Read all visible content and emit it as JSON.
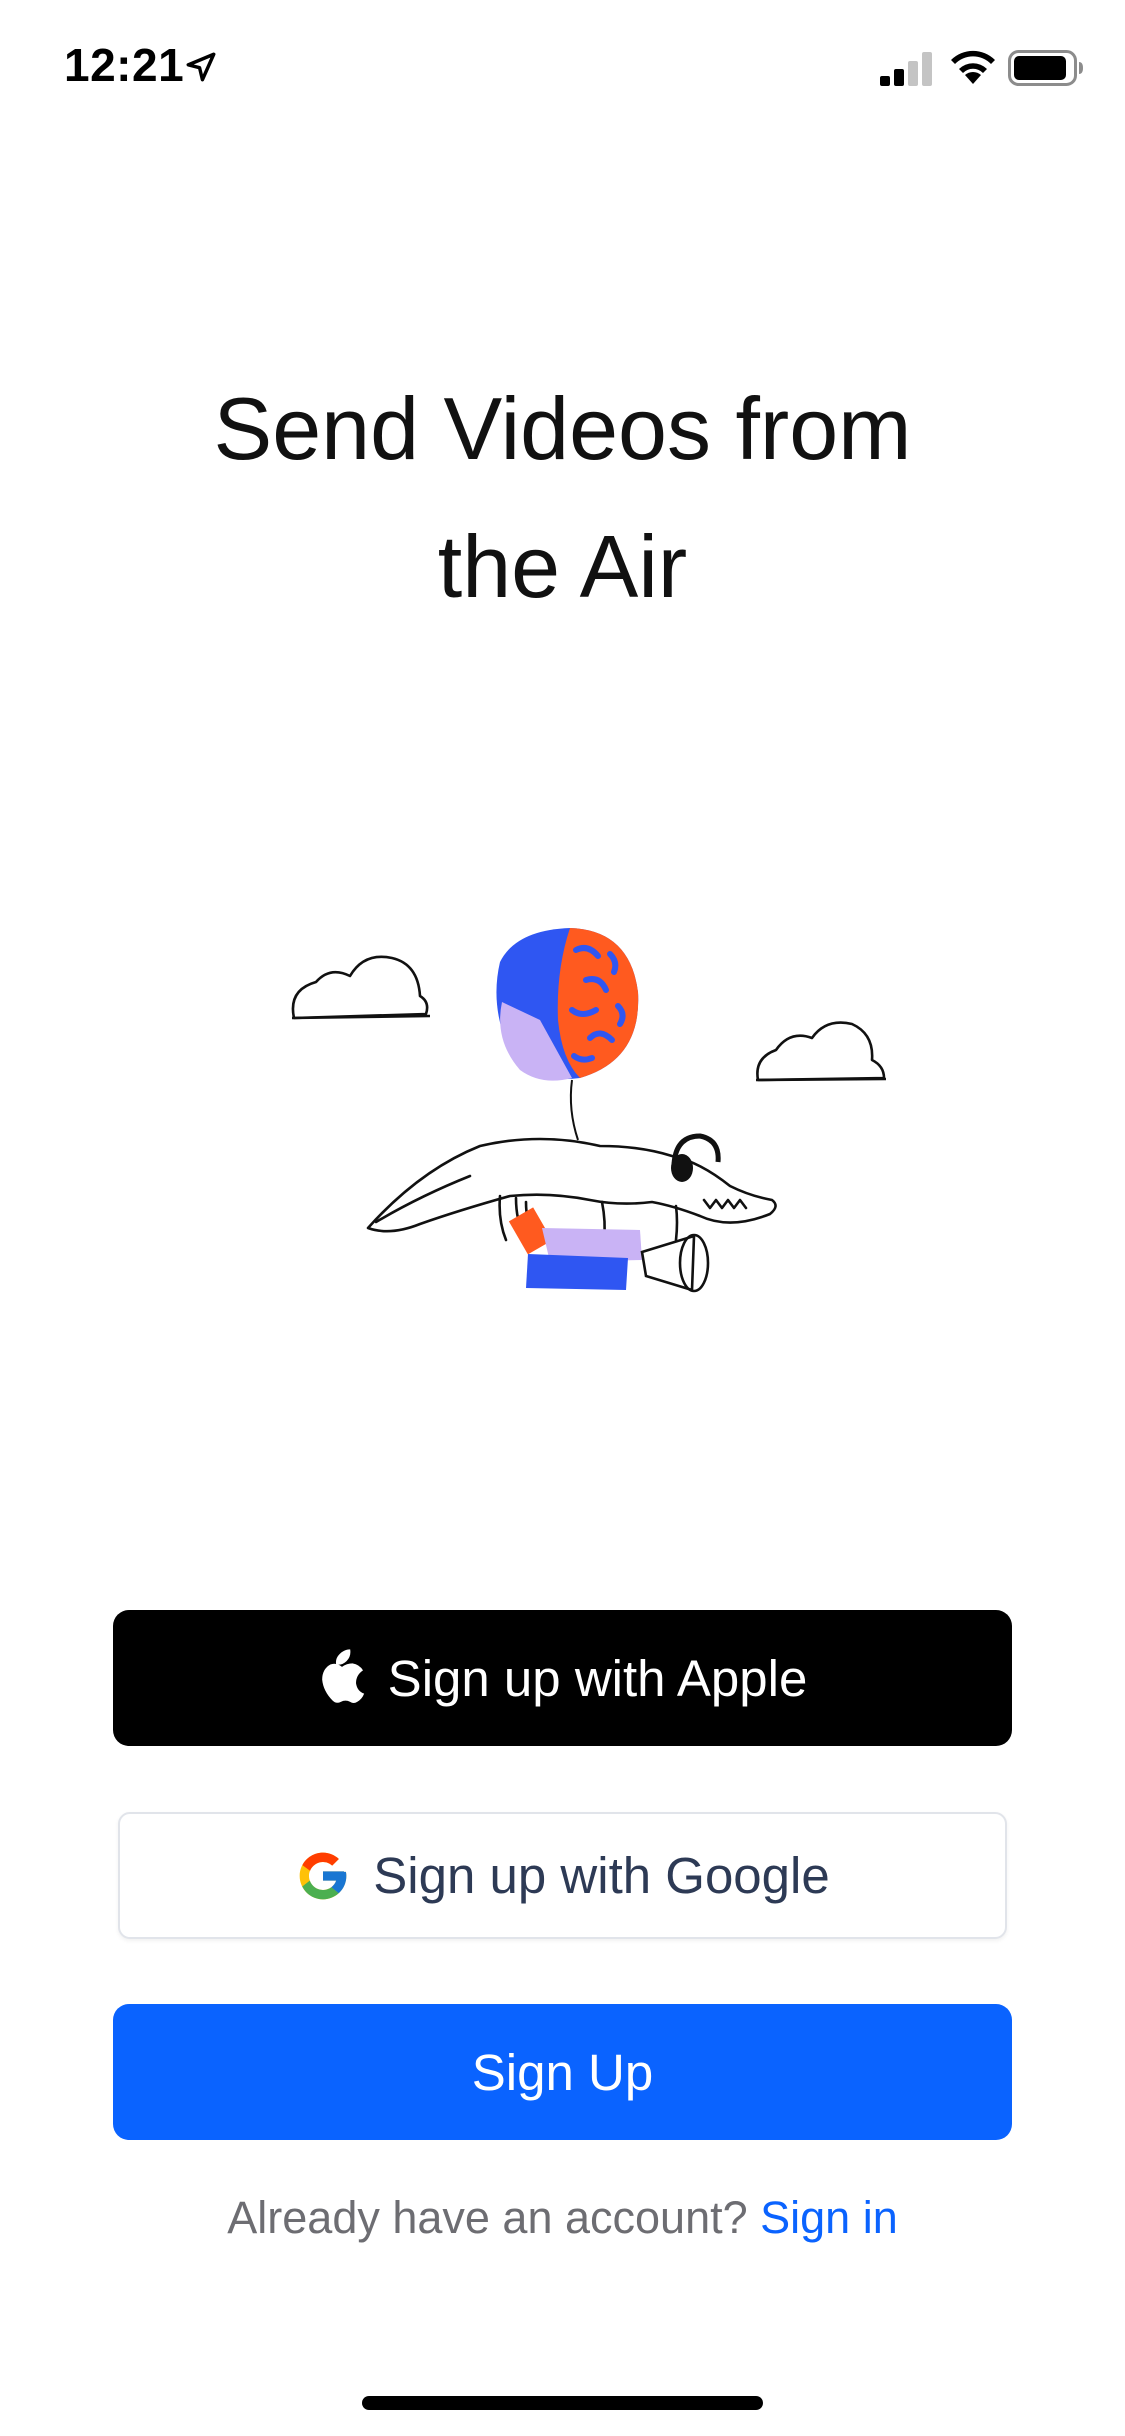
{
  "status_bar": {
    "time": "12:21",
    "location_icon": "location-arrow-icon",
    "signal_icon": "cellular-signal-icon",
    "wifi_icon": "wifi-icon",
    "battery_icon": "battery-icon"
  },
  "headline": {
    "line1": "Send Videos from",
    "line2": "the Air"
  },
  "illustration": {
    "icon": "crocodile-balloon-illustration",
    "colors": {
      "blue": "#2f56f2",
      "orange": "#ff5a1f",
      "lavender": "#c9b3f5"
    }
  },
  "buttons": {
    "apple": {
      "label": "Sign up with Apple",
      "icon": "apple-logo-icon",
      "bg": "#000000"
    },
    "google": {
      "label": "Sign up with Google",
      "icon": "google-logo-icon",
      "text_color": "#2d3a55"
    },
    "signup": {
      "label": "Sign Up",
      "bg": "#0a63ff"
    }
  },
  "signin": {
    "prompt": "Already have an account?",
    "link": "Sign in",
    "link_color": "#0a63ff"
  }
}
